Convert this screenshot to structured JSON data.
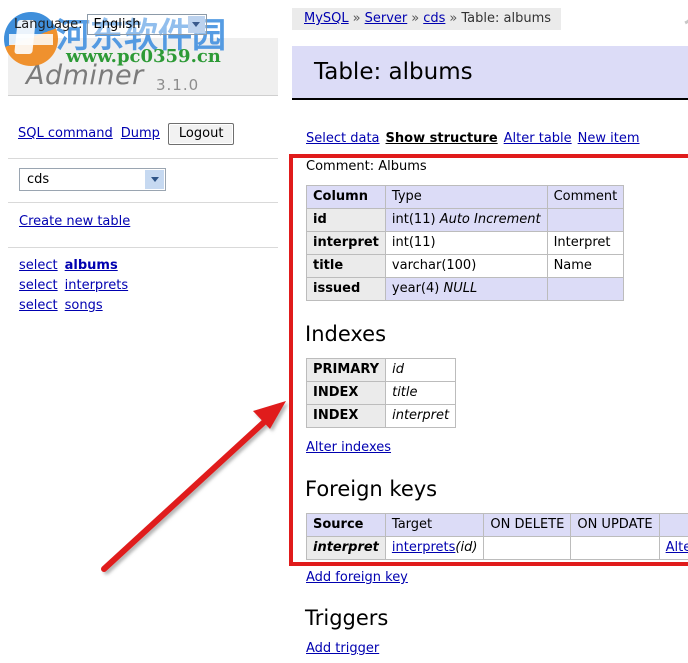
{
  "app": {
    "name": "Adminer",
    "version": "3.1.0"
  },
  "watermark": {
    "cn_text": "河东软件园",
    "url_text": "www.pc0359.cn",
    "logo_name": "site-logo"
  },
  "sidebar": {
    "language": {
      "label": "Language:",
      "value": "English"
    },
    "links": {
      "sql_command": "SQL command",
      "dump": "Dump",
      "logout": "Logout"
    },
    "database": {
      "value": "cds"
    },
    "create_new_table": "Create new table",
    "tables": [
      {
        "select": "select",
        "name": "albums",
        "current": true
      },
      {
        "select": "select",
        "name": "interprets",
        "current": false
      },
      {
        "select": "select",
        "name": "songs",
        "current": false
      }
    ]
  },
  "content": {
    "breadcrumb": {
      "items": [
        "MySQL",
        "Server",
        "cds"
      ],
      "separator": "»",
      "current": "Table: albums"
    },
    "page_title": "Table: albums",
    "tabs": [
      {
        "label": "Select data",
        "active": false
      },
      {
        "label": "Show structure",
        "active": true
      },
      {
        "label": "Alter table",
        "active": false
      },
      {
        "label": "New item",
        "active": false
      }
    ],
    "comment": "Comment: Albums",
    "columns_table": {
      "headers": [
        "Column",
        "Type",
        "Comment"
      ],
      "rows": [
        {
          "column": "id",
          "type": "int(11) ",
          "type_em": "Auto Increment",
          "comment": "",
          "highlight": true
        },
        {
          "column": "interpret",
          "type": "int(11)",
          "type_em": "",
          "comment": "Interpret",
          "highlight": false
        },
        {
          "column": "title",
          "type": "varchar(100)",
          "type_em": "",
          "comment": "Name",
          "highlight": false
        },
        {
          "column": "issued",
          "type": "year(4) ",
          "type_em": "NULL",
          "comment": "",
          "highlight": true
        }
      ]
    },
    "indexes": {
      "heading": "Indexes",
      "rows": [
        {
          "type": "PRIMARY",
          "columns": "id"
        },
        {
          "type": "INDEX",
          "columns": "title"
        },
        {
          "type": "INDEX",
          "columns": "interpret"
        }
      ],
      "alter_link": "Alter indexes"
    },
    "foreign_keys": {
      "heading": "Foreign keys",
      "headers": [
        "Source",
        "Target",
        "ON DELETE",
        "ON UPDATE",
        ""
      ],
      "rows": [
        {
          "source": "interpret",
          "target_table": "interprets",
          "target_col": "(id)",
          "on_delete": "",
          "on_update": "",
          "action": "Alter"
        }
      ],
      "add_link": "Add foreign key"
    },
    "triggers": {
      "heading": "Triggers",
      "add_link": "Add trigger"
    }
  },
  "annotations": {
    "highlight_color": "#e01b1b",
    "box_name": "structure-highlight-box",
    "arrow_name": "pointer-arrow"
  }
}
